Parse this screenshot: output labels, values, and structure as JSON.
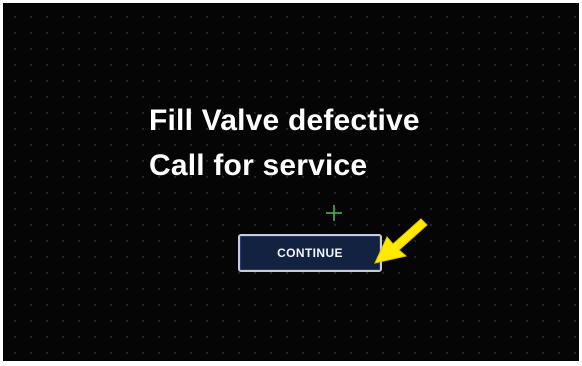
{
  "dialog": {
    "message_line1": "Fill Valve defective",
    "message_line2": "Call for service",
    "continue_label": "CONTINUE"
  },
  "colors": {
    "background": "#050505",
    "text": "#ffffff",
    "button_fill": "#142242",
    "button_border": "#c8ccd6",
    "crosshair": "#4caf50",
    "annotation_arrow": "#ffea00"
  },
  "icons": {
    "crosshair": "crosshair-icon",
    "annotation": "arrow-pointer-icon"
  }
}
